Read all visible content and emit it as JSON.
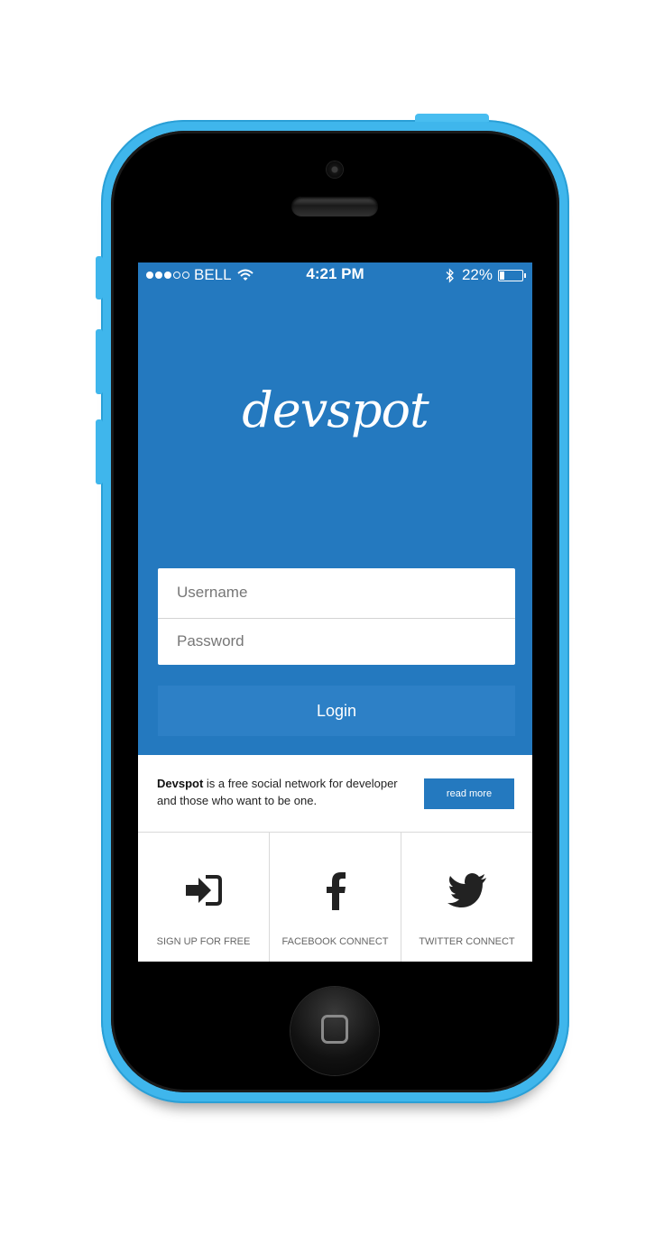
{
  "statusbar": {
    "carrier": "BELL",
    "time": "4:21 PM",
    "battery_pct": "22%",
    "battery_level": 0.22,
    "signal_bars": 3,
    "signal_total": 5
  },
  "app": {
    "logo": "devspot",
    "username_placeholder": "Username",
    "password_placeholder": "Password",
    "login_label": "Login",
    "brand_color": "#2479bf"
  },
  "info": {
    "brand": "Devspot",
    "description": " is a free social network for developer and those who want to be one.",
    "read_more_label": "read more"
  },
  "actions": [
    {
      "label": "SIGN UP FOR FREE",
      "icon": "sign-in-icon"
    },
    {
      "label": "FACEBOOK CONNECT",
      "icon": "facebook-icon"
    },
    {
      "label": "TWITTER CONNECT",
      "icon": "twitter-icon"
    }
  ]
}
